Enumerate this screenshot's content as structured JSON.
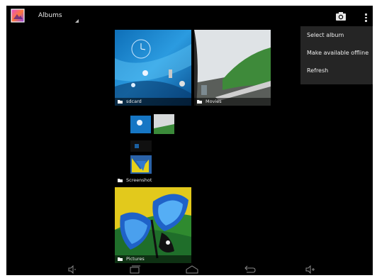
{
  "action_bar": {
    "title": "Albums",
    "camera_icon": "camera-icon",
    "overflow_icon": "overflow-menu-icon"
  },
  "overflow_menu": {
    "items": [
      {
        "label": "Select album"
      },
      {
        "label": "Make available offline"
      },
      {
        "label": "Refresh"
      }
    ]
  },
  "albums": [
    {
      "name": "sdcard",
      "icon": "folder-icon"
    },
    {
      "name": "Movies",
      "icon": "folder-icon"
    },
    {
      "name": "Screenshot",
      "icon": "folder-icon"
    },
    {
      "name": "Pictures",
      "icon": "folder-icon"
    }
  ],
  "nav_bar": {
    "icons": [
      "volume-down-icon",
      "recent-apps-icon",
      "home-icon",
      "back-icon",
      "volume-up-icon"
    ]
  },
  "colors": {
    "background": "#000000",
    "menu_bg": "#252525",
    "text": "#ededed"
  }
}
